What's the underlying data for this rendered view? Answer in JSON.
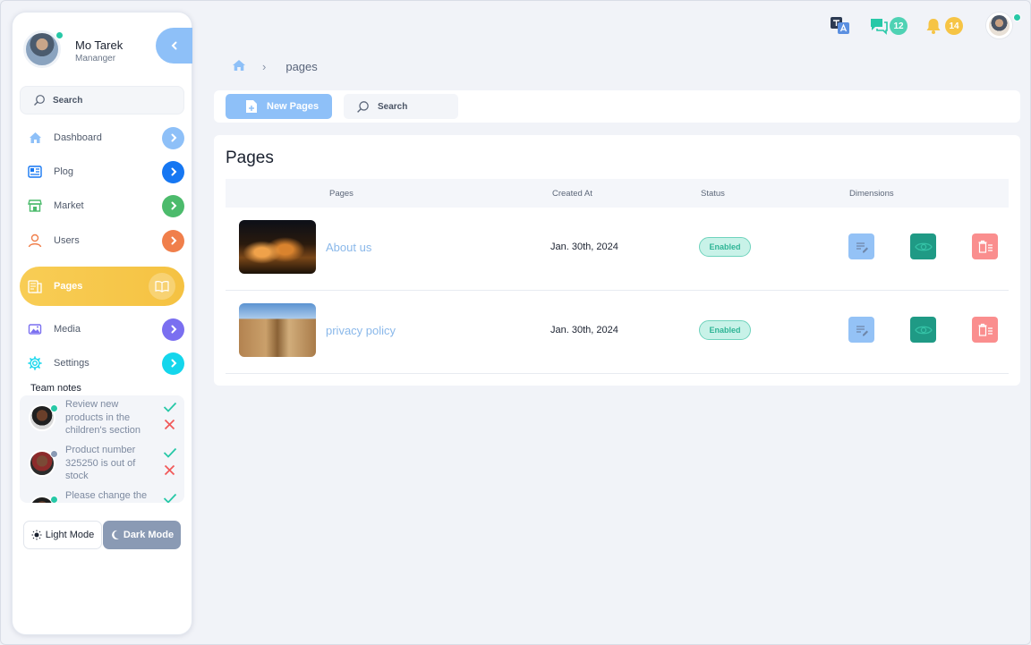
{
  "user": {
    "name": "Mo Tarek",
    "role": "Mananger"
  },
  "sidebar": {
    "search_placeholder": "Search",
    "items": [
      {
        "label": "Dashboard",
        "icon": "home-icon",
        "color": "#8ec0f8"
      },
      {
        "label": "Plog",
        "icon": "blog-icon",
        "color": "#1677f2"
      },
      {
        "label": "Market",
        "icon": "store-icon",
        "color": "#4cbb6c"
      },
      {
        "label": "Users",
        "icon": "user-icon",
        "color": "#f07f4b"
      },
      {
        "label": "Pages",
        "icon": "pages-icon",
        "color": "#f6c445",
        "active": true
      },
      {
        "label": "Media",
        "icon": "media-icon",
        "color": "#7a6ff0"
      },
      {
        "label": "Settings",
        "icon": "gear-icon",
        "color": "#14d6ec"
      }
    ],
    "team_notes_title": "Team notes",
    "notes": [
      {
        "text": "Review new products in the children's section",
        "status_color": "#27c8a7"
      },
      {
        "text": "Product number 325250 is out of stock",
        "status_color": "#8a9ab4"
      },
      {
        "text": "Please change the",
        "status_color": "#27c8a7"
      }
    ],
    "light_mode_label": "Light Mode",
    "dark_mode_label": "Dark Mode"
  },
  "topbar": {
    "messages_count": "12",
    "notifications_count": "14"
  },
  "breadcrumb": {
    "current": "pages"
  },
  "toolbar": {
    "new_button_label": "New Pages",
    "search_placeholder": "Search"
  },
  "pages_card": {
    "title": "Pages",
    "columns": [
      "Pages",
      "Created At",
      "Status",
      "Dimensions"
    ],
    "rows": [
      {
        "name": "About us",
        "created_at": "Jan. 30th, 2024",
        "status": "Enabled"
      },
      {
        "name": "privacy policy",
        "created_at": "Jan. 30th, 2024",
        "status": "Enabled"
      }
    ]
  },
  "colors": {
    "accent": "#8ec0f8",
    "active": "#f6c445",
    "success": "#2fb596",
    "danger": "#fa8e8e",
    "view": "#1f9a85"
  }
}
